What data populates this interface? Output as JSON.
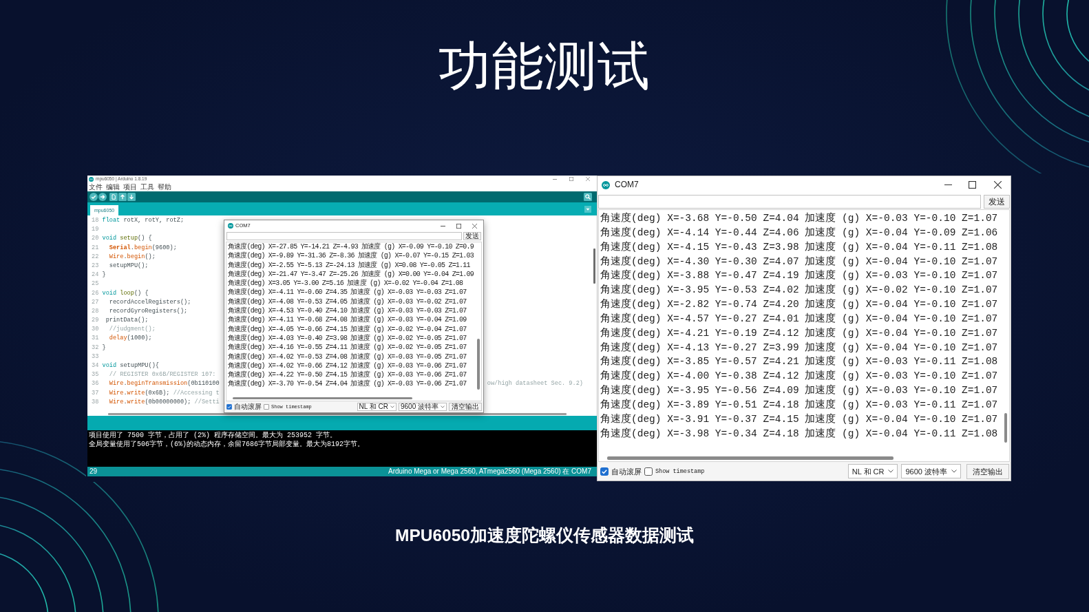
{
  "slide": {
    "title": "功能测试",
    "subtitle": "MPU6050加速度陀螺仪传感器数据测试"
  },
  "ide_window": {
    "title": "mpu6050 | Arduino 1.8.19",
    "menu": [
      "文件",
      "编辑",
      "项目",
      "工具",
      "帮助"
    ],
    "tabs": [
      {
        "label": "mpu6050",
        "selected": true
      }
    ],
    "code_lines": [
      {
        "number": "18",
        "tokens": [
          {
            "text": "float",
            "kind": "keyword"
          },
          {
            "text": " rotX, rotY, rotZ;",
            "kind": "plain"
          }
        ]
      },
      {
        "number": "19"
      },
      {
        "number": "20",
        "tokens": [
          {
            "text": "void",
            "kind": "keyword"
          },
          {
            "text": " setup",
            "kind": "structure"
          },
          {
            "text": "() {",
            "kind": "plain"
          }
        ]
      },
      {
        "number": "21",
        "tokens": [
          {
            "text": "  Serial",
            "kind": "class"
          },
          {
            "text": ".",
            "kind": "plain"
          },
          {
            "text": "begin",
            "kind": "function"
          },
          {
            "text": "(9600);",
            "kind": "plain"
          }
        ]
      },
      {
        "number": "22",
        "tokens": [
          {
            "text": "  Wire",
            "kind": "function"
          },
          {
            "text": ".",
            "kind": "plain"
          },
          {
            "text": "begin",
            "kind": "function"
          },
          {
            "text": "();",
            "kind": "plain"
          }
        ]
      },
      {
        "number": "23",
        "tokens": [
          {
            "text": "  setupMPU();",
            "kind": "plain"
          }
        ]
      },
      {
        "number": "24",
        "tokens": [
          {
            "text": "}",
            "kind": "plain"
          }
        ]
      },
      {
        "number": "25"
      },
      {
        "number": "26",
        "tokens": [
          {
            "text": "void",
            "kind": "keyword"
          },
          {
            "text": " loop",
            "kind": "structure"
          },
          {
            "text": "() {",
            "kind": "plain"
          }
        ]
      },
      {
        "number": "27",
        "tokens": [
          {
            "text": "  recordAccelRegisters();",
            "kind": "plain"
          }
        ]
      },
      {
        "number": "28",
        "tokens": [
          {
            "text": "  recordGyroRegisters();",
            "kind": "plain"
          }
        ]
      },
      {
        "number": "29",
        "tokens": [
          {
            "text": " printData();",
            "kind": "plain"
          }
        ]
      },
      {
        "number": "30",
        "tokens": [
          {
            "text": "  //judgment();",
            "kind": "comment"
          }
        ]
      },
      {
        "number": "31",
        "tokens": [
          {
            "text": "  delay",
            "kind": "function"
          },
          {
            "text": "(1000);",
            "kind": "plain"
          }
        ]
      },
      {
        "number": "32",
        "tokens": [
          {
            "text": "}",
            "kind": "plain"
          }
        ]
      },
      {
        "number": "33"
      },
      {
        "number": "34",
        "tokens": [
          {
            "text": "void",
            "kind": "keyword"
          },
          {
            "text": " setupMPU(){",
            "kind": "plain"
          }
        ]
      },
      {
        "number": "35",
        "tokens": [
          {
            "text": "  // REGISTER 0x6B/REGISTER 107:",
            "kind": "comment"
          }
        ]
      },
      {
        "number": "36",
        "tokens": [
          {
            "text": "  Wire",
            "kind": "function"
          },
          {
            "text": ".",
            "kind": "plain"
          },
          {
            "text": "beginTransmission",
            "kind": "function"
          },
          {
            "text": "(0b110100",
            "kind": "plain"
          }
        ],
        "tail": "ow/high datasheet Sec. 9.2)"
      },
      {
        "number": "37",
        "tokens": [
          {
            "text": "  Wire",
            "kind": "function"
          },
          {
            "text": ".",
            "kind": "plain"
          },
          {
            "text": "write",
            "kind": "function"
          },
          {
            "text": "(0x6B); ",
            "kind": "plain"
          },
          {
            "text": "//Accessing t",
            "kind": "comment"
          }
        ]
      },
      {
        "number": "38",
        "tokens": [
          {
            "text": "  Wire",
            "kind": "function"
          },
          {
            "text": ".",
            "kind": "plain"
          },
          {
            "text": "write",
            "kind": "function"
          },
          {
            "text": "(0b00000000); ",
            "kind": "plain"
          },
          {
            "text": "//Setti",
            "kind": "comment"
          }
        ]
      }
    ],
    "serial_monitor": {
      "title": "COM7",
      "send_button": "发送",
      "lines": [
        "角速度(deg) X=-27.85 Y=-14.21 Z=-4.93 加速度 (g) X=-0.09 Y=-0.10 Z=0.9",
        "角速度(deg) X=-9.89 Y=-31.36 Z=-8.36 加速度 (g) X=-0.07 Y=-0.15 Z=1.03",
        "角速度(deg) X=-2.55 Y=-5.13 Z=-24.13 加速度 (g) X=0.08 Y=-0.05 Z=1.11",
        "角速度(deg) X=-21.47 Y=-3.47 Z=-25.26 加速度 (g) X=0.00 Y=-0.04 Z=1.09",
        "角速度(deg) X=3.05 Y=-3.00 Z=5.16 加速度 (g) X=-0.02 Y=-0.04 Z=1.08",
        "角速度(deg) X=-4.11 Y=-0.60 Z=4.35 加速度 (g) X=-0.03 Y=-0.03 Z=1.07",
        "角速度(deg) X=-4.08 Y=-0.53 Z=4.05 加速度 (g) X=-0.03 Y=-0.02 Z=1.07",
        "角速度(deg) X=-4.53 Y=-0.40 Z=4.10 加速度 (g) X=-0.03 Y=-0.03 Z=1.07",
        "角速度(deg) X=-4.11 Y=-0.68 Z=4.08 加速度 (g) X=-0.03 Y=-0.04 Z=1.09",
        "角速度(deg) X=-4.05 Y=-0.66 Z=4.15 加速度 (g) X=-0.02 Y=-0.04 Z=1.07",
        "角速度(deg) X=-4.03 Y=-0.40 Z=3.98 加速度 (g) X=-0.02 Y=-0.05 Z=1.07",
        "角速度(deg) X=-4.16 Y=-0.55 Z=4.11 加速度 (g) X=-0.02 Y=-0.05 Z=1.07",
        "角速度(deg) X=-4.02 Y=-0.53 Z=4.08 加速度 (g) X=-0.03 Y=-0.05 Z=1.07",
        "角速度(deg) X=-4.02 Y=-0.66 Z=4.12 加速度 (g) X=-0.03 Y=-0.06 Z=1.07",
        "角速度(deg) X=-4.22 Y=-0.50 Z=4.15 加速度 (g) X=-0.03 Y=-0.06 Z=1.07",
        "角速度(deg) X=-3.70 Y=-0.54 Z=4.04 加速度 (g) X=-0.03 Y=-0.06 Z=1.07"
      ],
      "autoscroll": {
        "label": "自动滚屏",
        "checked": true
      },
      "timestamp": {
        "label": "Show timestamp",
        "checked": false
      },
      "line_ending": "NL 和 CR",
      "baud_rate": "9600 波特率",
      "clear_button": "清空输出"
    },
    "console_lines": [
      "项目使用了 7500 字节，占用了 (2%) 程序存储空间。最大为 253952 字节。",
      "全局变量使用了506字节，(6%)的动态内存，余留7686字节局部变量。最大为8192字节。"
    ],
    "status": {
      "line": "29",
      "board": "Arduino Mega or Mega 2560, ATmega2560 (Mega 2560) 在 COM7"
    }
  },
  "serial_monitor": {
    "title": "COM7",
    "send_button": "发送",
    "lines": [
      "角速度(deg) X=-3.68 Y=-0.50 Z=4.04 加速度 (g) X=-0.03 Y=-0.10 Z=1.07",
      "角速度(deg) X=-4.14 Y=-0.44 Z=4.06 加速度 (g) X=-0.04 Y=-0.09 Z=1.06",
      "角速度(deg) X=-4.15 Y=-0.43 Z=3.98 加速度 (g) X=-0.04 Y=-0.11 Z=1.08",
      "角速度(deg) X=-4.30 Y=-0.30 Z=4.07 加速度 (g) X=-0.04 Y=-0.10 Z=1.07",
      "角速度(deg) X=-3.88 Y=-0.47 Z=4.19 加速度 (g) X=-0.03 Y=-0.10 Z=1.07",
      "角速度(deg) X=-3.95 Y=-0.53 Z=4.02 加速度 (g) X=-0.02 Y=-0.10 Z=1.07",
      "角速度(deg) X=-2.82 Y=-0.74 Z=4.20 加速度 (g) X=-0.04 Y=-0.10 Z=1.07",
      "角速度(deg) X=-4.57 Y=-0.27 Z=4.01 加速度 (g) X=-0.04 Y=-0.10 Z=1.07",
      "角速度(deg) X=-4.21 Y=-0.19 Z=4.12 加速度 (g) X=-0.04 Y=-0.10 Z=1.07",
      "角速度(deg) X=-4.13 Y=-0.27 Z=3.99 加速度 (g) X=-0.04 Y=-0.10 Z=1.07",
      "角速度(deg) X=-3.85 Y=-0.57 Z=4.21 加速度 (g) X=-0.03 Y=-0.11 Z=1.08",
      "角速度(deg) X=-4.00 Y=-0.38 Z=4.12 加速度 (g) X=-0.03 Y=-0.10 Z=1.07",
      "角速度(deg) X=-3.95 Y=-0.56 Z=4.09 加速度 (g) X=-0.03 Y=-0.10 Z=1.07",
      "角速度(deg) X=-3.89 Y=-0.51 Z=4.18 加速度 (g) X=-0.03 Y=-0.11 Z=1.07",
      "角速度(deg) X=-3.91 Y=-0.37 Z=4.15 加速度 (g) X=-0.04 Y=-0.10 Z=1.07",
      "角速度(deg) X=-3.98 Y=-0.34 Z=4.18 加速度 (g) X=-0.04 Y=-0.11 Z=1.08"
    ],
    "autoscroll": {
      "label": "自动滚屏",
      "checked": true
    },
    "timestamp": {
      "label": "Show timestamp",
      "checked": false
    },
    "line_ending": "NL 和 CR",
    "baud_rate": "9600 波特率",
    "clear_button": "清空输出"
  }
}
